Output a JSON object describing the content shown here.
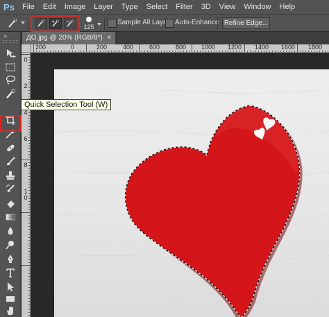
{
  "app": {
    "logo": "Ps"
  },
  "menu": [
    "File",
    "Edit",
    "Image",
    "Layer",
    "Type",
    "Select",
    "Filter",
    "3D",
    "View",
    "Window",
    "Help"
  ],
  "options": {
    "brush_size": "125",
    "sample_all_layers": "Sample All Layers",
    "auto_enhance": "Auto-Enhance",
    "refine_edge": "Refine Edge...",
    "sample_all_layers_checked": false,
    "auto_enhance_checked": false
  },
  "document": {
    "tab_title": "ДО.jpg @ 20% (RGB/8*)",
    "tab_close": "×"
  },
  "rulers": {
    "top": [
      "200",
      "0",
      "200",
      "400",
      "600",
      "800",
      "1000",
      "1200",
      "1400",
      "1600",
      "1800"
    ],
    "left": [
      "0",
      "2",
      "4",
      "6",
      "8",
      "1",
      "0"
    ]
  },
  "tooltip": {
    "text": "Quick Selection Tool (W)"
  },
  "colors": {
    "highlight": "#e2241f",
    "heart": "#d4161b",
    "ui_dark": "#535353"
  },
  "icons": [
    "move-icon",
    "marquee-icon",
    "lasso-icon",
    "quick-selection-icon",
    "crop-icon",
    "eyedropper-icon",
    "healing-brush-icon",
    "brush-icon",
    "clone-stamp-icon",
    "history-brush-icon",
    "eraser-icon",
    "gradient-icon",
    "blur-icon",
    "dodge-icon",
    "pen-icon",
    "type-icon",
    "path-selection-icon",
    "shape-icon",
    "hand-icon",
    "zoom-icon"
  ]
}
